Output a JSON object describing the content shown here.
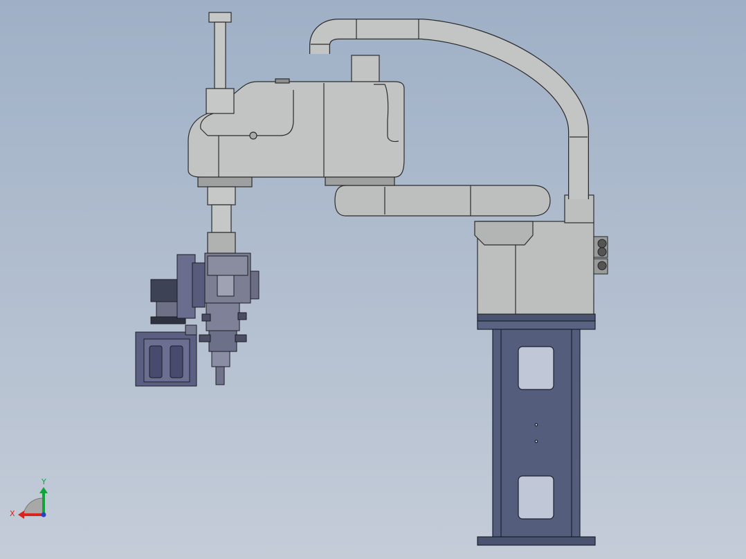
{
  "viewport": {
    "background_top": "#9fb0c6",
    "background_bottom": "#c4ccd8"
  },
  "model": {
    "robot_color": "#bfc1c1",
    "edge_color": "#2b2b2b",
    "base_color": "#565f7d",
    "gripper_color": "#6f7390"
  },
  "triad": {
    "x_label": "X",
    "y_label": "Y",
    "x_color": "#d8241c",
    "y_color": "#12a33a",
    "z_color": "#2d3fc4"
  }
}
